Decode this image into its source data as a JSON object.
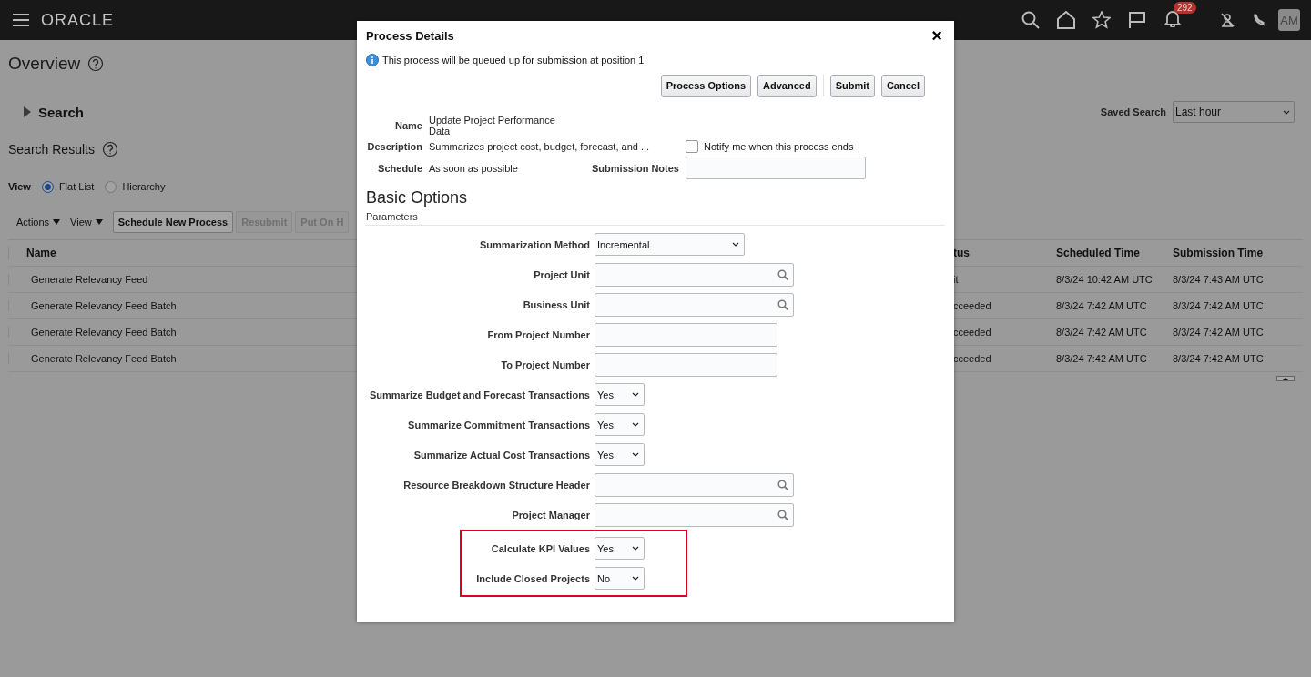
{
  "header": {
    "logo": "ORACLE",
    "notification_count": "292",
    "avatar": "AM"
  },
  "page": {
    "title": "Overview",
    "search": {
      "label": "Search",
      "expanded": false
    },
    "saved_search": {
      "label": "Saved Search",
      "value": "Last hour"
    },
    "results_title": "Search Results",
    "view": {
      "label": "View",
      "options": [
        {
          "label": "Flat List",
          "selected": true
        },
        {
          "label": "Hierarchy",
          "selected": false
        }
      ]
    },
    "toolbar": {
      "menus": [
        "Actions",
        "View"
      ],
      "buttons": [
        {
          "label": "Schedule New Process",
          "disabled": false
        },
        {
          "label": "Resubmit",
          "disabled": true
        },
        {
          "label": "Put On H",
          "disabled": true
        }
      ]
    },
    "table": {
      "columns": [
        "Name",
        "tus",
        "Scheduled Time",
        "Submission Time"
      ],
      "rows": [
        {
          "name": "Generate Relevancy Feed",
          "status": "it",
          "scheduled": "8/3/24 10:42 AM UTC",
          "submitted": "8/3/24 7:43 AM UTC"
        },
        {
          "name": "Generate Relevancy Feed Batch",
          "status": "cceeded",
          "scheduled": "8/3/24 7:42 AM UTC",
          "submitted": "8/3/24 7:42 AM UTC"
        },
        {
          "name": "Generate Relevancy Feed Batch",
          "status": "cceeded",
          "scheduled": "8/3/24 7:42 AM UTC",
          "submitted": "8/3/24 7:42 AM UTC"
        },
        {
          "name": "Generate Relevancy Feed Batch",
          "status": "cceeded",
          "scheduled": "8/3/24 7:42 AM UTC",
          "submitted": "8/3/24 7:42 AM UTC"
        }
      ]
    }
  },
  "dialog": {
    "title": "Process Details",
    "close": "×",
    "info": "This process will be queued up for submission at position 1",
    "buttons": [
      "Process Options",
      "Advanced",
      "Submit",
      "Cancel"
    ],
    "fields": {
      "name_label": "Name",
      "name": "Update Project Performance Data",
      "description_label": "Description",
      "description": "Summarizes project cost, budget, forecast, and ...",
      "schedule_label": "Schedule",
      "schedule": "As soon as possible",
      "submission_notes_label": "Submission Notes"
    },
    "notify": {
      "label": "Notify me when this process ends",
      "checked": false
    },
    "section_title": "Basic Options",
    "parameters_label": "Parameters",
    "parameters": [
      {
        "label": "Summarization Method",
        "kind": "select",
        "value": "Incremental",
        "highlighted": false
      },
      {
        "label": "Project Unit",
        "kind": "lookup",
        "highlighted": false
      },
      {
        "label": "Business Unit",
        "kind": "lookup",
        "highlighted": false
      },
      {
        "label": "From Project Number",
        "kind": "text",
        "highlighted": false
      },
      {
        "label": "To Project Number",
        "kind": "text",
        "highlighted": false
      },
      {
        "label": "Summarize Budget and Forecast Transactions",
        "kind": "select",
        "value": "Yes",
        "highlighted": false
      },
      {
        "label": "Summarize Commitment Transactions",
        "kind": "select",
        "value": "Yes",
        "highlighted": false
      },
      {
        "label": "Summarize Actual Cost Transactions",
        "kind": "select",
        "value": "Yes",
        "highlighted": false
      },
      {
        "label": "Resource Breakdown Structure Header",
        "kind": "lookup",
        "highlighted": false
      },
      {
        "label": "Project Manager",
        "kind": "lookup",
        "highlighted": false
      },
      {
        "label": "Calculate KPI Values",
        "kind": "select",
        "value": "Yes",
        "highlighted": true
      },
      {
        "label": "Include Closed Projects",
        "kind": "select",
        "value": "No",
        "highlighted": true
      }
    ]
  }
}
